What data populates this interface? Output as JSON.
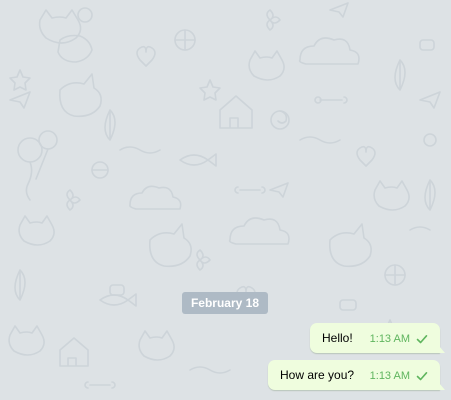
{
  "chat": {
    "date_badge": "February 18",
    "messages": [
      {
        "text": "Hello!",
        "time": "1:13 AM",
        "status_icon": "check-icon"
      },
      {
        "text": "How are you?",
        "time": "1:13 AM",
        "status_icon": "check-icon"
      }
    ]
  },
  "colors": {
    "wallpaper": "#dde2e5",
    "date_badge_bg": "#aebac5",
    "outgoing_bubble": "#effdde",
    "time_and_check": "#5fb55e"
  }
}
